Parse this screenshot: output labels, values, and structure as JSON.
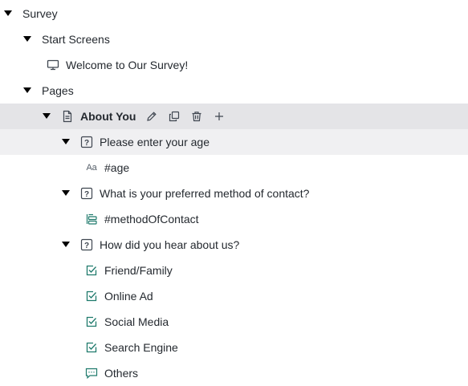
{
  "tree": {
    "survey": {
      "label": "Survey"
    },
    "start_screens": {
      "label": "Start Screens",
      "items": [
        {
          "label": "Welcome to Our Survey!",
          "icon": "monitor-icon"
        }
      ]
    },
    "pages": {
      "label": "Pages",
      "page": {
        "label": "About You",
        "icon": "page-icon",
        "actions": [
          {
            "name": "edit",
            "icon": "pencil-icon"
          },
          {
            "name": "duplicate",
            "icon": "copy-icon"
          },
          {
            "name": "delete",
            "icon": "trash-icon"
          },
          {
            "name": "add",
            "icon": "plus-icon"
          }
        ],
        "questions": [
          {
            "label": "Please enter your age",
            "icon": "question-icon",
            "children": [
              {
                "label": "#age",
                "icon": "text-field-icon",
                "icon_text": "Aa"
              }
            ]
          },
          {
            "label": "What is your preferred method of contact?",
            "icon": "question-icon",
            "children": [
              {
                "label": "#methodOfContact",
                "icon": "dropdown-list-icon"
              }
            ]
          },
          {
            "label": "How did you hear about us?",
            "icon": "question-icon",
            "children": [
              {
                "label": "Friend/Family",
                "icon": "checkbox-icon"
              },
              {
                "label": "Online Ad",
                "icon": "checkbox-icon"
              },
              {
                "label": "Social Media",
                "icon": "checkbox-icon"
              },
              {
                "label": "Search Engine",
                "icon": "checkbox-icon"
              },
              {
                "label": "Others",
                "icon": "comment-icon"
              }
            ]
          }
        ]
      }
    }
  },
  "colors": {
    "selected_row": "#e4e4e7",
    "hover_row": "#f0f0f2",
    "text": "#24292f",
    "icon": "#3f4650",
    "checkbox_accent": "#1f7a6c"
  }
}
